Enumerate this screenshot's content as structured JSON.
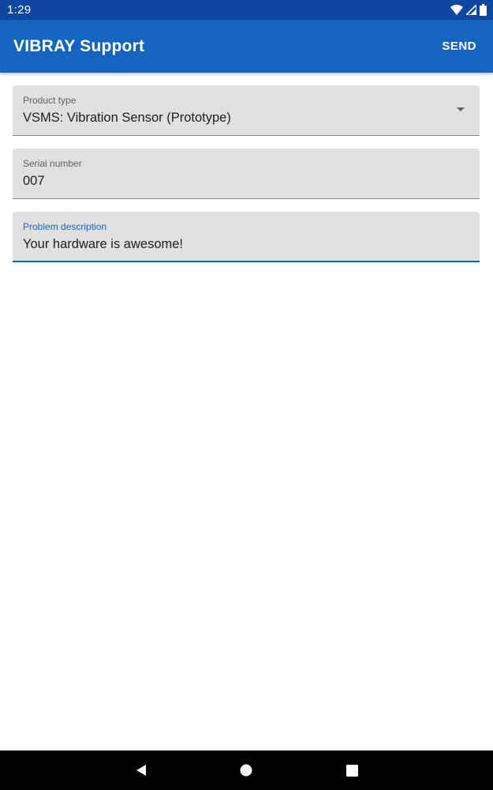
{
  "status_bar": {
    "time": "1:29",
    "icons": [
      "wifi-icon",
      "signal-icon",
      "battery-icon"
    ]
  },
  "app_bar": {
    "title": "VIBRAY Support",
    "send_label": "SEND"
  },
  "form": {
    "product_type": {
      "label": "Product type",
      "value": "VSMS: Vibration Sensor (Prototype)"
    },
    "serial_number": {
      "label": "Serial number",
      "value": "007"
    },
    "problem_description": {
      "label": "Problem description",
      "value": "Your hardware is awesome!"
    }
  },
  "nav_bar": {
    "icons": [
      "back-icon",
      "home-icon",
      "recents-icon"
    ]
  },
  "colors": {
    "status_bar": "#0d47a1",
    "primary": "#1565c0",
    "field_bg": "#e0e0e0",
    "nav_bar": "#000000"
  }
}
